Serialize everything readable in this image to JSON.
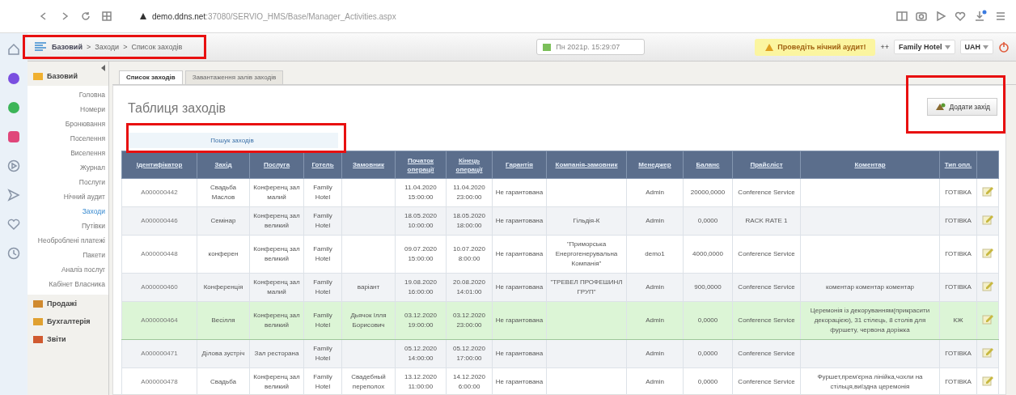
{
  "browser": {
    "url_host": "demo.ddns.net",
    "url_path": ":37080/SERVIO_HMS/Base/Manager_Activities.aspx"
  },
  "header": {
    "breadcrumb": [
      {
        "label": "Базовий"
      },
      {
        "label": "Заходи"
      },
      {
        "label": "Список заходів"
      }
    ],
    "separator": ">",
    "date": "Пн 2021р. 15:29:07",
    "warning": "Проведіть нічний аудит!",
    "arrows": "++",
    "hotel": "Family Hotel",
    "currency": "UAH"
  },
  "tabs": [
    {
      "label": "Список заходів",
      "selected": true
    },
    {
      "label": "Завантаження залів заходів",
      "selected": false
    }
  ],
  "sidebar": {
    "section": "Базовий",
    "items": [
      {
        "label": "Головна",
        "selected": false
      },
      {
        "label": "Номери",
        "selected": false
      },
      {
        "label": "Бронювання",
        "selected": false
      },
      {
        "label": "Поселення",
        "selected": false
      },
      {
        "label": "Виселення",
        "selected": false
      },
      {
        "label": "Журнал",
        "selected": false
      },
      {
        "label": "Послуги",
        "selected": false
      },
      {
        "label": "Нічний аудит",
        "selected": false
      },
      {
        "label": "Заходи",
        "selected": true
      },
      {
        "label": "Путівки",
        "selected": false
      },
      {
        "label": "Необроблені платежі",
        "selected": false
      },
      {
        "label": "Пакети",
        "selected": false
      },
      {
        "label": "Аналіз послуг",
        "selected": false
      },
      {
        "label": "Кабінет Власника",
        "selected": false
      }
    ],
    "groups": [
      {
        "label": "Продажі"
      },
      {
        "label": "Бухгалтерія"
      },
      {
        "label": "Звіти"
      }
    ]
  },
  "page_title": "Таблиця заходів",
  "search_link": "Пошук заходів",
  "add_button": "Додати захід",
  "table": {
    "columns": [
      "Ідентифікатор",
      "Захід",
      "Послуга",
      "Готель",
      "Замовник",
      "Початок операції",
      "Кінець операції",
      "Гарантія",
      "Компанія-замовник",
      "Менеджер",
      "Баланс",
      "Прайсліст",
      "Коментар",
      "Тип опл."
    ],
    "rows": [
      {
        "selected": false,
        "cells": [
          "A000000442",
          "Свадьба Маслов",
          "Конференц зал малий",
          "Family Hotel",
          "",
          "11.04.2020 15:00:00",
          "11.04.2020 23:00:00",
          "Не гарантована",
          "",
          "Admin",
          "20000,0000",
          "Conference Service",
          "",
          "ГОТІВКА"
        ]
      },
      {
        "selected": false,
        "cells": [
          "A000000446",
          "Семінар",
          "Конференц зал великий",
          "Family Hotel",
          "",
          "18.05.2020 10:00:00",
          "18.05.2020 18:00:00",
          "Не гарантована",
          "Гільдія-К",
          "Admin",
          "0,0000",
          "RACK RATE 1",
          "",
          "ГОТІВКА"
        ]
      },
      {
        "selected": false,
        "cells": [
          "A000000448",
          "конферен",
          "Конференц зал великий",
          "Family Hotel",
          "",
          "09.07.2020 15:00:00",
          "10.07.2020 8:00:00",
          "Не гарантована",
          "\"Приморська Енергогенерувальна Компанія\"",
          "demo1",
          "4000,0000",
          "Conference Service",
          "",
          "ГОТІВКА"
        ]
      },
      {
        "selected": false,
        "cells": [
          "A000000460",
          "Конференція",
          "Конференц зал малий",
          "Family Hotel",
          "варіант",
          "19.08.2020 16:00:00",
          "20.08.2020 14:01:00",
          "Не гарантована",
          "\"ТРЕВЕЛ ПРОФЕШИНЛ ГРУП\"",
          "Admin",
          "900,0000",
          "Conference Service",
          "коментар коментар коментар",
          "ГОТІВКА"
        ]
      },
      {
        "selected": true,
        "cells": [
          "A000000464",
          "Весілля",
          "Конференц зал великий",
          "Family Hotel",
          "Дьячок Ілля Борисович",
          "03.12.2020 19:00:00",
          "03.12.2020 23:00:00",
          "Не гарантована",
          "",
          "Admin",
          "0,0000",
          "Conference Service",
          "Церемонія із декоруванням(прикрасити декорацією), 31 стілець, 8 столів для фуршету, червона доріжка",
          "КЖ"
        ]
      },
      {
        "selected": false,
        "cells": [
          "A000000471",
          "Ділова зустріч",
          "Зал ресторана",
          "Family Hotel",
          "",
          "05.12.2020 14:00:00",
          "05.12.2020 17:00:00",
          "Не гарантована",
          "",
          "Admin",
          "0,0000",
          "Conference Service",
          "",
          "ГОТІВКА"
        ]
      },
      {
        "selected": false,
        "cells": [
          "A000000478",
          "Свадьба",
          "Конференц зал великий",
          "Family Hotel",
          "Свадебный переполох",
          "13.12.2020 11:00:00",
          "14.12.2020 6:00:00",
          "Не гарантована",
          "",
          "Admin",
          "0,0000",
          "Conference Service",
          "Фуршет,прем'єрна лінійка,чохли на стільця,виїздна церемонія",
          "ГОТІВКА"
        ]
      }
    ]
  },
  "annotations": [
    {
      "kind": "frame"
    },
    {
      "kind": "frame"
    },
    {
      "kind": "frame"
    }
  ]
}
